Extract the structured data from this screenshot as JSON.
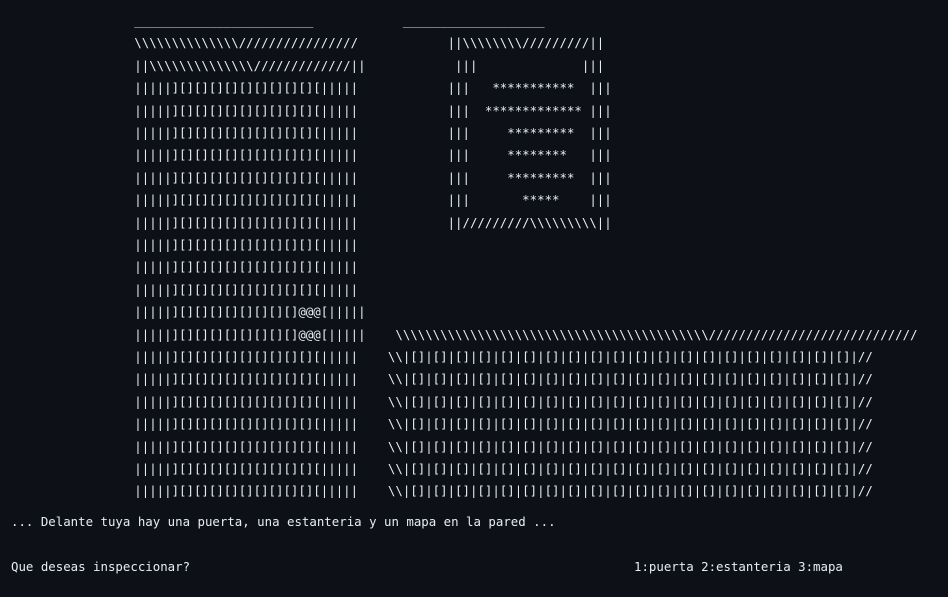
{
  "scene": {
    "lines": [
      "                  ________________________            ___________________",
      "                  \\\\\\\\\\\\\\\\\\\\\\\\\\\\////////////////            ||\\\\\\\\\\\\\\\\/////////||",
      "                  ||\\\\\\\\\\\\\\\\\\\\\\\\\\\\/////////////||            |||              |||",
      "                  |||||][][][][][][][][][][|||||            |||   ***********  |||",
      "                  |||||][][][][][][][][][][|||||            |||  ************* |||",
      "                  |||||][][][][][][][][][][|||||            |||     *********  |||",
      "                  |||||][][][][][][][][][][|||||            |||     ********   |||",
      "                  |||||][][][][][][][][][][|||||            |||     *********  |||",
      "                  |||||][][][][][][][][][][|||||            |||       *****    |||",
      "                  |||||][][][][][][][][][][|||||            ||/////////\\\\\\\\\\\\\\\\\\||",
      "                  |||||][][][][][][][][][][|||||",
      "                  |||||][][][][][][][][][][|||||",
      "                  |||||][][][][][][][][][][|||||",
      "                  |||||][][][][][][][][]@@@[|||||",
      "                  |||||][][][][][][][][]@@@[|||||    \\\\\\\\\\\\\\\\\\\\\\\\\\\\\\\\\\\\\\\\\\\\\\\\\\\\\\\\\\\\\\\\\\\\\\\\\\\\\\\\\\\\////////////////////////////",
      "                  |||||][][][][][][][][][][|||||    \\\\|[]|[]|[]|[]|[]|[]|[]|[]|[]|[]|[]|[]|[]|[]|[]|[]|[]|[]|[]|[]|//",
      "                  |||||][][][][][][][][][][|||||    \\\\|[]|[]|[]|[]|[]|[]|[]|[]|[]|[]|[]|[]|[]|[]|[]|[]|[]|[]|[]|[]|//",
      "                  |||||][][][][][][][][][][|||||    \\\\|[]|[]|[]|[]|[]|[]|[]|[]|[]|[]|[]|[]|[]|[]|[]|[]|[]|[]|[]|[]|//",
      "                  |||||][][][][][][][][][][|||||    \\\\|[]|[]|[]|[]|[]|[]|[]|[]|[]|[]|[]|[]|[]|[]|[]|[]|[]|[]|[]|[]|//",
      "                  |||||][][][][][][][][][][|||||    \\\\|[]|[]|[]|[]|[]|[]|[]|[]|[]|[]|[]|[]|[]|[]|[]|[]|[]|[]|[]|[]|//",
      "                  |||||][][][][][][][][][][|||||    \\\\|[]|[]|[]|[]|[]|[]|[]|[]|[]|[]|[]|[]|[]|[]|[]|[]|[]|[]|[]|[]|//",
      "                  |||||][][][][][][][][][][|||||    \\\\|[]|[]|[]|[]|[]|[]|[]|[]|[]|[]|[]|[]|[]|[]|[]|[]|[]|[]|[]|[]|//",
      "__________________|||||][][][][][][][][][][|||||____________\\\\\\\\\\\\\\\\\\\\\\\\\\\\\\\\\\\\\\\\\\\\\\\\\\\\\\\\\\\\\\\\\\\\\\\\\\\\\\\\\\\\\\\\////////////////////////////______"
    ],
    "description": "... Delante tuya hay una puerta, una estanteria y un mapa en la pared ...",
    "question": "Que deseas inspeccionar?",
    "options": "1:puerta 2:estanteria 3:mapa"
  }
}
